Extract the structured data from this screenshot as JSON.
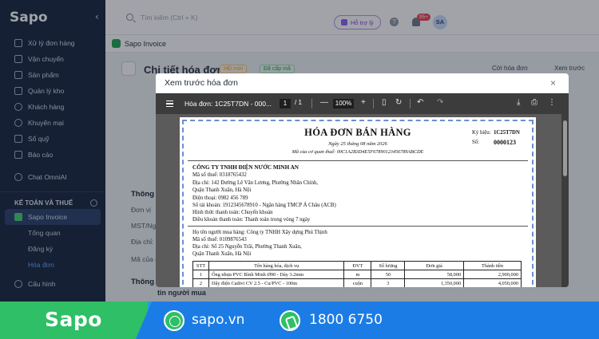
{
  "brand": "Sapo",
  "sidebar": {
    "items": [
      {
        "label": "Xử lý đơn hàng"
      },
      {
        "label": "Vận chuyển"
      },
      {
        "label": "Sản phẩm"
      },
      {
        "label": "Quản lý kho"
      },
      {
        "label": "Khách hàng"
      },
      {
        "label": "Khuyến mại"
      },
      {
        "label": "Sổ quỹ"
      },
      {
        "label": "Báo cáo"
      },
      {
        "label": "Chat OmniAI"
      }
    ],
    "section": "KẾ TOÁN VÀ THUẾ",
    "active_item": "Sapo Invoice",
    "sub_items": [
      {
        "label": "Tổng quan"
      },
      {
        "label": "Đăng ký"
      },
      {
        "label": "Hóa đơn"
      }
    ],
    "bottom_item": "Cấu hình"
  },
  "topbar": {
    "search_placeholder": "Tìm kiếm (Ctrl + K)",
    "help_label": "Hỗ trợ lỳ",
    "help_icon": "?",
    "notif_badge": "95+",
    "avatar": "SA"
  },
  "appbar": {
    "title": "Sapo Invoice"
  },
  "page": {
    "title": "Chi tiết hóa đơn",
    "tag_hd": "HĐ mới",
    "tag_cap": "Đã cấp mã",
    "action_copy": "Cời hóa đơn",
    "action_view": "Xem trước",
    "labels": [
      "Thông t",
      "Đơn vị",
      "MST/Ngư",
      "Địa chỉ:",
      "Mã của n",
      "Thông t"
    ],
    "below_text": "tin người mua"
  },
  "modal": {
    "title": "Xem trước hóa đơn",
    "close": "×",
    "pdf": {
      "filename": "Hóa đơn: 1C25T7DN - 000...",
      "page": "1",
      "page_total": "/  1",
      "zoom_minus": "—",
      "zoom": "100%",
      "zoom_plus": "+"
    }
  },
  "invoice": {
    "title": "HÓA ĐƠN BÁN HÀNG",
    "date": "Ngày 25 tháng 08 năm 2026",
    "authority_code": "Mã của cơ quan thuế: 00C1A2B3D4E5F67890123456789ABCDE",
    "symbol_label": "Ký hiệu:",
    "symbol_value": "1C25T7DN",
    "number_label": "Số:",
    "number_value": "0000123",
    "seller_name": "CÔNG TY TNHH ĐIỆN NƯỚC MINH AN",
    "seller_lines": [
      "Mã số thuế: 0318765432",
      "Địa chỉ: 142 Đường Lê Văn Lương, Phường Nhân Chính,",
      "Quận Thanh Xuân, Hà Nội",
      "Điện thoại: 0982 456 789",
      "Số tài khoản: 1912345678910 - Ngân hàng TMCP Á Châu (ACB)",
      "Hình thức thanh toán: Chuyển khoản",
      "Điều khoản thanh toán: Thanh toán trong vòng 7 ngày"
    ],
    "buyer_lines": [
      "Họ tên người mua hàng: Công ty TNHH Xây dựng Phú Thịnh",
      "Mã số thuế: 0109876543",
      "Địa chỉ: Số 25 Nguyễn Trãi, Phường Thanh Xuân,",
      "Quận Thanh Xuân, Hà Nội"
    ],
    "table": {
      "headers": [
        "STT",
        "Tên hàng hóa, dịch vụ",
        "ĐVT",
        "Số lượng",
        "Đơn giá",
        "Thành tiền"
      ],
      "rows": [
        [
          "1",
          "Ống nhựa PVC Bình Minh Ø90 - Dày 3.2mm",
          "m",
          "50",
          "58,000",
          "2,900,000"
        ],
        [
          "2",
          "Dây điện Cadivi CV 2.5 - Cu/PVC - 100m",
          "cuộn",
          "3",
          "1,350,000",
          "4,050,000"
        ]
      ]
    }
  },
  "footer": {
    "logo": "Sapo",
    "website": "sapo.vn",
    "phone": "1800 6750"
  }
}
